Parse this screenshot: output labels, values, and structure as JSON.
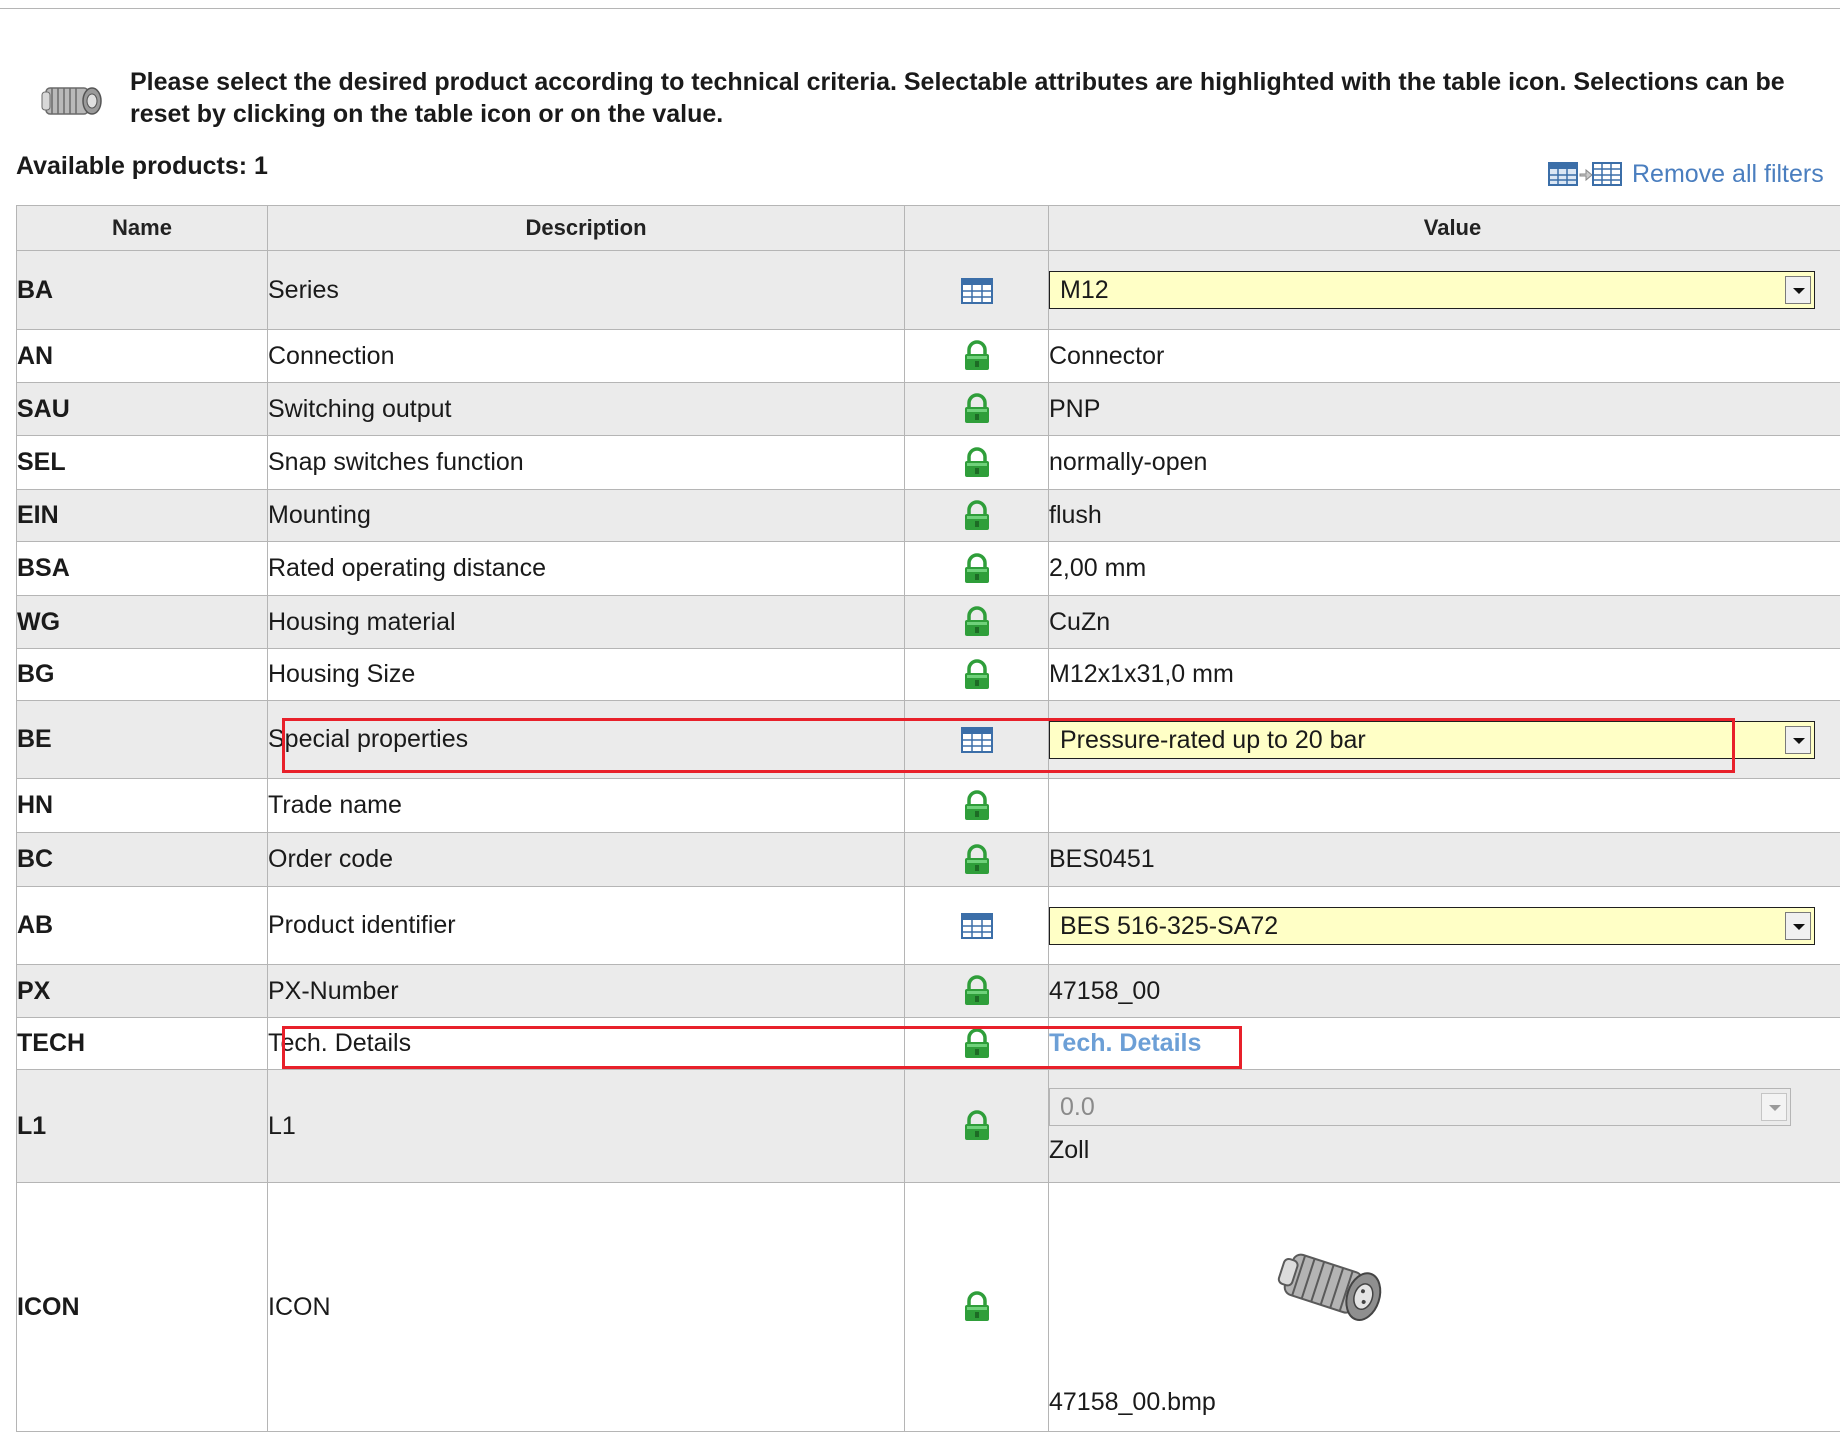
{
  "intro": {
    "icon": "sensor-icon",
    "text": "Please select the desired product according to technical criteria. Selectable attributes are highlighted with the table icon. Selections can be reset by clicking on the table icon or on the value."
  },
  "summary": {
    "available_label": "Available products: 1",
    "remove_filters_label": "Remove all filters",
    "remove_filters_icon": "table-reset-icon"
  },
  "table": {
    "headers": {
      "name": "Name",
      "description": "Description",
      "icon": "",
      "value": "Value"
    },
    "rows": [
      {
        "name": "BA",
        "description": "Series",
        "icon": "table-icon",
        "value": "M12",
        "control": "select"
      },
      {
        "name": "AN",
        "description": "Connection",
        "icon": "lock-icon",
        "value": "Connector"
      },
      {
        "name": "SAU",
        "description": "Switching output",
        "icon": "lock-icon",
        "value": "PNP"
      },
      {
        "name": "SEL",
        "description": "Snap switches function",
        "icon": "lock-icon",
        "value": "normally-open"
      },
      {
        "name": "EIN",
        "description": "Mounting",
        "icon": "lock-icon",
        "value": "flush"
      },
      {
        "name": "BSA",
        "description": "Rated operating distance",
        "icon": "lock-icon",
        "value": "2,00 mm"
      },
      {
        "name": "WG",
        "description": "Housing material",
        "icon": "lock-icon",
        "value": "CuZn"
      },
      {
        "name": "BG",
        "description": "Housing Size",
        "icon": "lock-icon",
        "value": "M12x1x31,0 mm"
      },
      {
        "name": "BE",
        "description": "Special properties",
        "icon": "table-icon",
        "value": "Pressure-rated up to 20 bar",
        "control": "select"
      },
      {
        "name": "HN",
        "description": "Trade name",
        "icon": "lock-icon",
        "value": ""
      },
      {
        "name": "BC",
        "description": "Order code",
        "icon": "lock-icon",
        "value": "BES0451"
      },
      {
        "name": "AB",
        "description": "Product identifier",
        "icon": "table-icon",
        "value": "BES 516-325-SA72",
        "control": "select"
      },
      {
        "name": "PX",
        "description": "PX-Number",
        "icon": "lock-icon",
        "value": "47158_00"
      },
      {
        "name": "TECH",
        "description": "Tech. Details",
        "icon": "lock-icon",
        "value": "Tech. Details",
        "control": "link"
      },
      {
        "name": "L1",
        "description": "L1",
        "icon": "lock-icon",
        "value": "0.0",
        "unit": "Zoll",
        "control": "disabled-select"
      },
      {
        "name": "ICON",
        "description": "ICON",
        "icon": "lock-icon",
        "value": "47158_00.bmp",
        "control": "image",
        "image_icon": "sensor-icon"
      }
    ]
  },
  "colors": {
    "highlight_border": "#e8202a",
    "select_background": "#ffffc6",
    "link": "#6c9fd6",
    "lock_icon": "#2f9e3a",
    "stripe": "#ebebeb"
  }
}
